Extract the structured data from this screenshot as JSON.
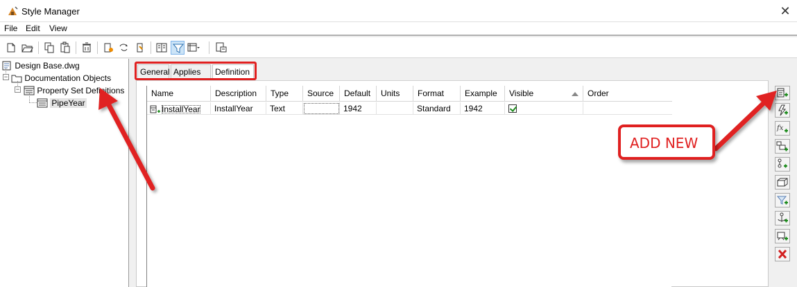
{
  "window": {
    "title": "Style Manager",
    "close_glyph": "✕"
  },
  "menu": {
    "items": [
      "File",
      "Edit",
      "View"
    ]
  },
  "tree": {
    "root": "Design Base.dwg",
    "level1": "Documentation Objects",
    "level2": "Property Set Definitions",
    "level3": "PipeYear"
  },
  "tabs": [
    "General",
    "Applies To",
    "Definition"
  ],
  "active_tab": "Definition",
  "grid": {
    "columns": [
      "Name",
      "Description",
      "Type",
      "Source",
      "Default",
      "Units",
      "Format",
      "Example",
      "Visible",
      "Order"
    ],
    "rows": [
      {
        "name": "InstallYear",
        "description": "InstallYear",
        "type": "Text",
        "source": "",
        "default": "1942",
        "units": "",
        "format": "Standard",
        "example": "1942",
        "visible": true,
        "order": ""
      }
    ]
  },
  "annotation": {
    "callout": "ADD NEW",
    "color": "#e02020"
  },
  "side_buttons": [
    "add-property-icon",
    "add-automatic-property-icon",
    "add-formula-property-icon",
    "add-location-property-icon",
    "add-classification-property-icon",
    "add-material-property-icon",
    "add-graphic-property-icon",
    "add-anchor-property-icon",
    "add-project-property-icon",
    "delete-property-icon"
  ]
}
